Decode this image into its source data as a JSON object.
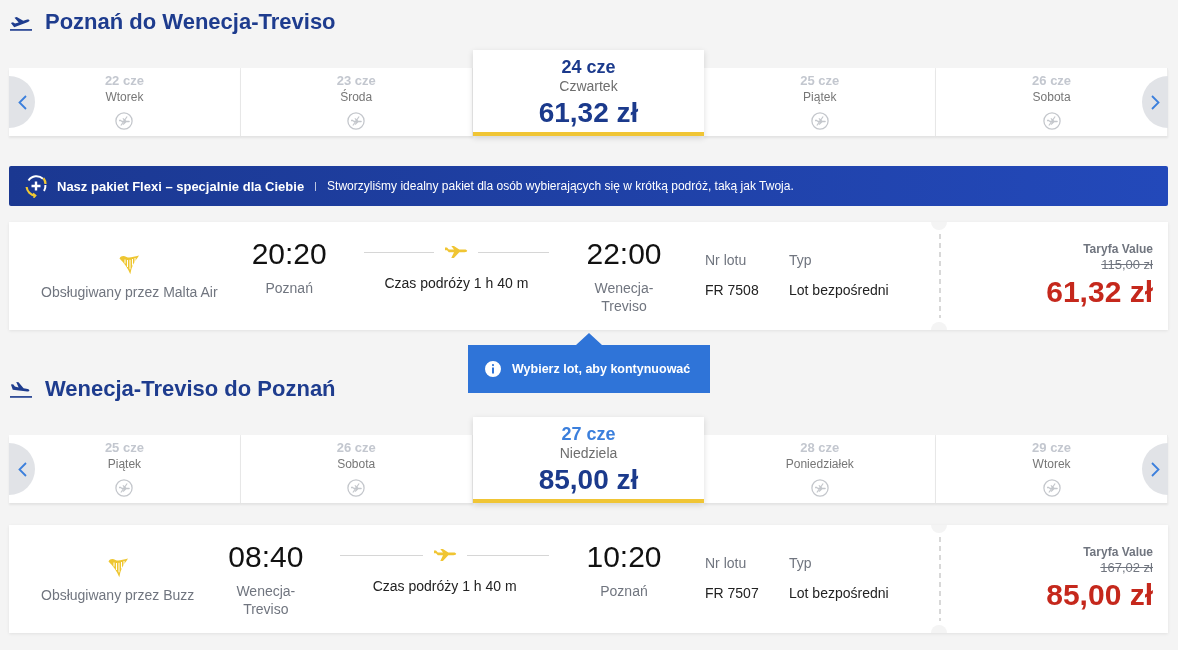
{
  "journeys": [
    {
      "kind": "outbound",
      "title": "Poznań do Wenecja-Treviso",
      "dates": [
        {
          "date": "22 cze",
          "weekday": "Wtorek",
          "selected": false,
          "hovered": false
        },
        {
          "date": "23 cze",
          "weekday": "Środa",
          "selected": false,
          "hovered": false
        },
        {
          "date": "24 cze",
          "weekday": "Czwartek",
          "price": "61,32 zł",
          "selected": true,
          "hovered": false
        },
        {
          "date": "25 cze",
          "weekday": "Piątek",
          "selected": false,
          "hovered": false
        },
        {
          "date": "26 cze",
          "weekday": "Sobota",
          "selected": false,
          "hovered": false
        }
      ],
      "banner": {
        "title": "Nasz pakiet Flexi – specjalnie dla Ciebie",
        "text": "Stworzyliśmy idealny pakiet dla osób wybierających się w krótką podróż, taką jak Twoja."
      },
      "flight": {
        "operator": "Obsługiwany przez Malta Air",
        "departure_time": "20:20",
        "departure_city": "Poznań",
        "duration": "Czas podróży 1 h 40 m",
        "arrival_time": "22:00",
        "arrival_city": "Wenecja-Treviso",
        "flight_number_label": "Nr lotu",
        "flight_number": "FR 7508",
        "type_label": "Typ",
        "type": "Lot bezpośredni",
        "fare": "Taryfa Value",
        "old_price": "115,00 zł",
        "price": "61,32 zł"
      },
      "tooltip": "Wybierz lot, aby kontynuować"
    },
    {
      "kind": "return",
      "title": "Wenecja-Treviso do Poznań",
      "dates": [
        {
          "date": "25 cze",
          "weekday": "Piątek",
          "selected": false,
          "hovered": false
        },
        {
          "date": "26 cze",
          "weekday": "Sobota",
          "selected": false,
          "hovered": false
        },
        {
          "date": "27 cze",
          "weekday": "Niedziela",
          "price": "85,00 zł",
          "selected": true,
          "hovered": true
        },
        {
          "date": "28 cze",
          "weekday": "Poniedziałek",
          "selected": false,
          "hovered": false
        },
        {
          "date": "29 cze",
          "weekday": "Wtorek",
          "selected": false,
          "hovered": false
        }
      ],
      "flight": {
        "operator": "Obsługiwany przez Buzz",
        "departure_time": "08:40",
        "departure_city": "Wenecja-Treviso",
        "duration": "Czas podróży 1 h 40 m",
        "arrival_time": "10:20",
        "arrival_city": "Poznań",
        "flight_number_label": "Nr lotu",
        "flight_number": "FR 7507",
        "type_label": "Typ",
        "type": "Lot bezpośredni",
        "fare": "Taryfa Value",
        "old_price": "167,02 zł",
        "price": "85,00 zł"
      }
    }
  ]
}
